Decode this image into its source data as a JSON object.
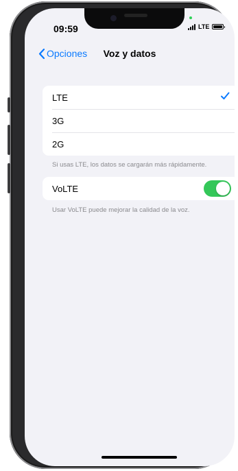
{
  "status_bar": {
    "time": "09:59",
    "network": "LTE"
  },
  "nav": {
    "back_label": "Opciones",
    "title": "Voz y datos"
  },
  "network_options": {
    "items": [
      {
        "label": "LTE",
        "selected": true
      },
      {
        "label": "3G",
        "selected": false
      },
      {
        "label": "2G",
        "selected": false
      }
    ],
    "footnote": "Si usas LTE, los datos se cargarán más rápidamente."
  },
  "volte": {
    "label": "VoLTE",
    "enabled": true,
    "footnote": "Usar VoLTE puede mejorar la calidad de la voz."
  },
  "colors": {
    "accent": "#0a7aff",
    "toggle_on": "#34c759",
    "background": "#f2f2f7"
  }
}
